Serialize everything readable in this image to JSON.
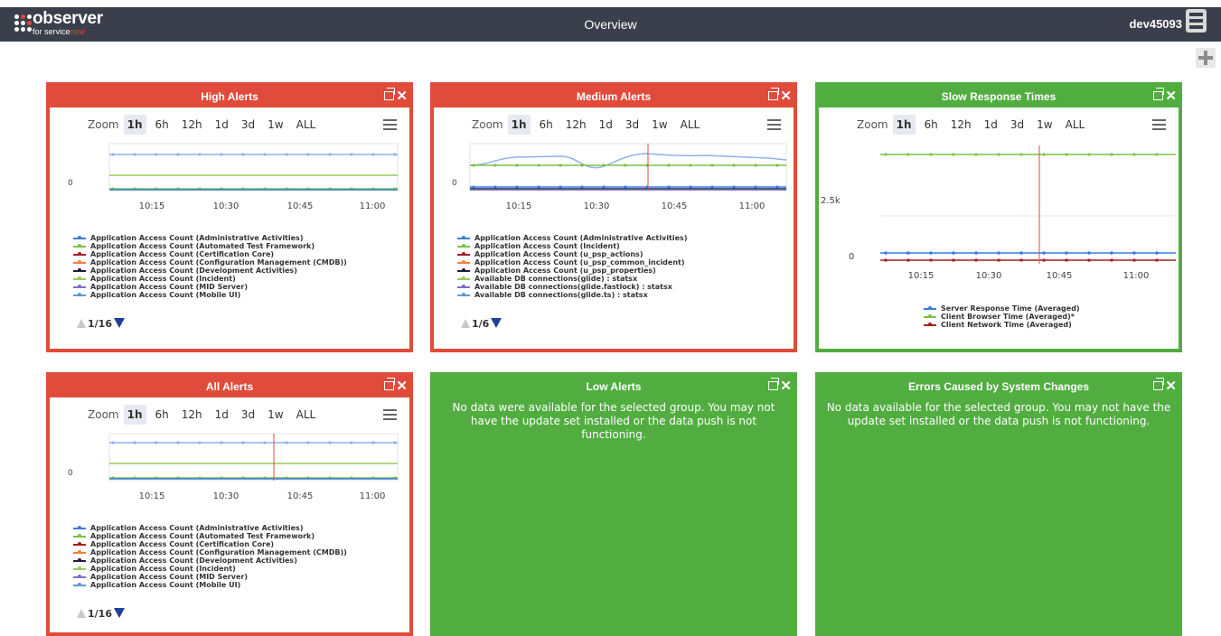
{
  "header": {
    "logo_text": "observer",
    "logo_sub_a": "for service",
    "logo_sub_b": "now",
    "title": "Overview",
    "user": "dev45093"
  },
  "colors": {
    "red": "#e04b3b",
    "green": "#51ad40",
    "header_bg": "#3a3f4b"
  },
  "zoom_options": [
    "Zoom",
    "1h",
    "6h",
    "12h",
    "1d",
    "3d",
    "1w",
    "ALL"
  ],
  "panels": {
    "high": {
      "title": "High Alerts",
      "pager": "1/16",
      "x_ticks": [
        "10:15",
        "10:30",
        "10:45",
        "11:00"
      ],
      "y_tick": "0",
      "legend": [
        {
          "name": "Application Access Count (Administrative Activities)",
          "color": "#3a7ddb"
        },
        {
          "name": "Application Access Count (Automated Test Framework)",
          "color": "#7cc244"
        },
        {
          "name": "Application Access Count (Certification Core)",
          "color": "#a31f1f"
        },
        {
          "name": "Application Access Count (Configuration Management (CMDB))",
          "color": "#f0823a"
        },
        {
          "name": "Application Access Count (Development Activities)",
          "color": "#1b1f3a"
        },
        {
          "name": "Application Access Count (Incident)",
          "color": "#95cc5a"
        },
        {
          "name": "Application Access Count (MID Server)",
          "color": "#7a6fc4"
        },
        {
          "name": "Application Access Count (Mobile UI)",
          "color": "#5b9bd9"
        }
      ]
    },
    "medium": {
      "title": "Medium Alerts",
      "pager": "1/6",
      "x_ticks": [
        "10:15",
        "10:30",
        "10:45",
        "11:00"
      ],
      "y_tick": "0",
      "legend": [
        {
          "name": "Application Access Count (Administrative Activities)",
          "color": "#3a7ddb"
        },
        {
          "name": "Application Access Count (Incident)",
          "color": "#7cc244"
        },
        {
          "name": "Application Access Count (u_psp_actions)",
          "color": "#a31f1f"
        },
        {
          "name": "Application Access Count (u_psp_common_incident)",
          "color": "#f0823a"
        },
        {
          "name": "Application Access Count (u_psp_properties)",
          "color": "#1b1f3a"
        },
        {
          "name": "Available DB connections(glide) : statsx",
          "color": "#95cc5a"
        },
        {
          "name": "Available DB connections(glide.fastlock) : statsx",
          "color": "#7a6fc4"
        },
        {
          "name": "Available DB connections(glide.ts) : statsx",
          "color": "#5b9bd9"
        }
      ]
    },
    "slow": {
      "title": "Slow Response Times",
      "x_ticks": [
        "10:15",
        "10:30",
        "10:45",
        "11:00"
      ],
      "y_ticks": [
        "2.5k",
        "0"
      ],
      "legend": [
        {
          "name": "Server Response Time (Averaged)",
          "color": "#3a7ddb"
        },
        {
          "name": "Client Browser Time (Averaged)*",
          "color": "#7cc244"
        },
        {
          "name": "Client Network Time (Averaged)",
          "color": "#a31f1f"
        }
      ]
    },
    "all": {
      "title": "All Alerts",
      "pager": "1/16",
      "x_ticks": [
        "10:15",
        "10:30",
        "10:45",
        "11:00"
      ],
      "y_tick": "0",
      "legend": [
        {
          "name": "Application Access Count (Administrative Activities)",
          "color": "#3a7ddb"
        },
        {
          "name": "Application Access Count (Automated Test Framework)",
          "color": "#7cc244"
        },
        {
          "name": "Application Access Count (Certification Core)",
          "color": "#a31f1f"
        },
        {
          "name": "Application Access Count (Configuration Management (CMDB))",
          "color": "#f0823a"
        },
        {
          "name": "Application Access Count (Development Activities)",
          "color": "#1b1f3a"
        },
        {
          "name": "Application Access Count (Incident)",
          "color": "#95cc5a"
        },
        {
          "name": "Application Access Count (MID Server)",
          "color": "#7a6fc4"
        },
        {
          "name": "Application Access Count (Mobile UI)",
          "color": "#5b9bd9"
        }
      ]
    },
    "low": {
      "title": "Low Alerts",
      "message": "No data were available for the selected group. You may not have the update set installed or the data push is not functioning."
    },
    "errors": {
      "title": "Errors Caused by System Changes",
      "message": "No data available for the selected group. You may not have the update set installed or the data push is not functioning."
    }
  }
}
